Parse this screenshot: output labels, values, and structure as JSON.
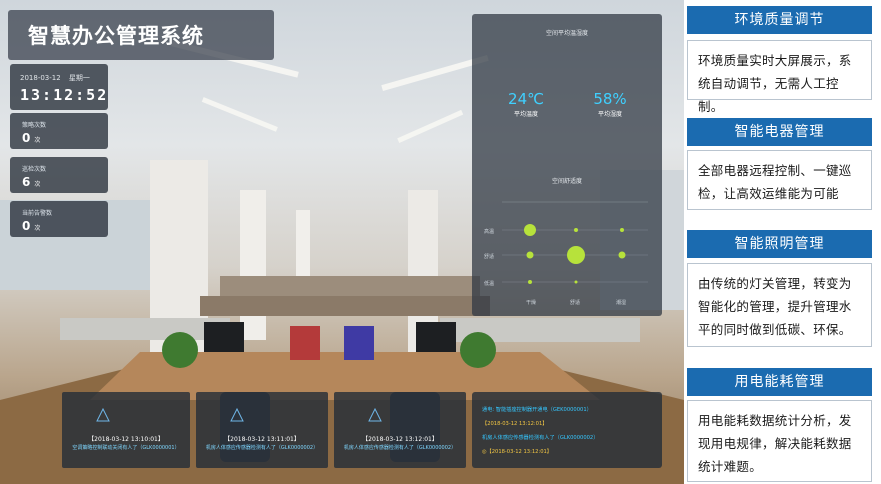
{
  "dashboard": {
    "title": "智慧办公管理系统",
    "date": "2018-03-12",
    "weekday": "星期一",
    "clock": "13:12:52",
    "stats": [
      {
        "label": "策略次数",
        "value": "0",
        "unit": "次"
      },
      {
        "label": "巡检次数",
        "value": "6",
        "unit": "次"
      },
      {
        "label": "当前告警数",
        "value": "0",
        "unit": "次"
      }
    ],
    "environment": {
      "header": "空间平均温湿度",
      "temperature": {
        "value": "24℃",
        "label": "平均温度"
      },
      "humidity": {
        "value": "58%",
        "label": "平均湿度"
      },
      "comfort_title": "空间舒适度",
      "y_labels": [
        "高温",
        "舒适",
        "低温"
      ],
      "x_labels": [
        "干燥",
        "舒适",
        "潮湿"
      ]
    },
    "alerts": [
      {
        "time": "【2018-03-12 13:10:01】",
        "message": "空调策略控制联动关闭有人了（GLK0000001）"
      },
      {
        "time": "【2018-03-12 13:11:01】",
        "message": "机房人体感应传感器检测有人了（GLK0000002）"
      },
      {
        "time": "【2018-03-12 13:12:01】",
        "message": "机房人体感应传感器检测有人了（GLK0000002）"
      }
    ],
    "logs": [
      {
        "text": "通电: 智能插座控制器开通电（GEK0000001）",
        "tone": "a"
      },
      {
        "text": "【2018-03-12 13:12:01】",
        "tone": "b"
      },
      {
        "text": "机房人体感应传感器检测有人了（GLK0000002）",
        "tone": "a"
      },
      {
        "text": "◎【2018-03-12 13:12:01】",
        "tone": "b"
      }
    ]
  },
  "features": [
    {
      "title": "环境质量调节",
      "lines": [
        "环境质量实时大屏展示，系",
        "统自动调节，无需人工控制。"
      ]
    },
    {
      "title": "智能电器管理",
      "lines": [
        "全部电器远程控制、一键巡",
        "检，让高效运维能为可能"
      ]
    },
    {
      "title": "智能照明管理",
      "lines": [
        "由传统的灯关管理，转变为",
        "智能化的管理，提升管理水",
        "平的同时做到低碳、环保。"
      ]
    },
    {
      "title": "用电能耗管理",
      "lines": [
        "用电能耗数据统计分析，发",
        "现用电规律，解决能耗数据",
        "统计难题。"
      ]
    }
  ],
  "colors": {
    "accent": "#1b6bb0",
    "highlight": "#3fd0ff",
    "bubble": "#b7e23b"
  }
}
